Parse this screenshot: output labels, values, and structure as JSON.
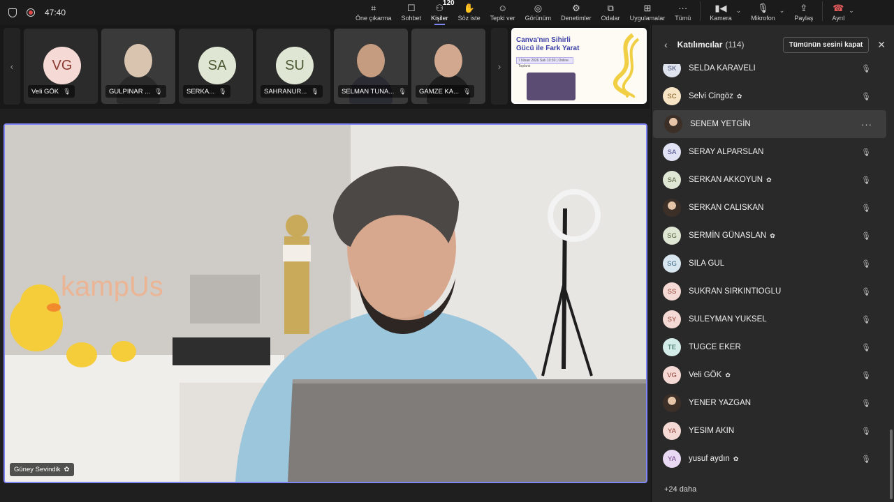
{
  "topbar": {
    "timer": "47:40",
    "actions": [
      {
        "label": "Öne çıkarma",
        "icon": "pin-icon"
      },
      {
        "label": "Sohbet",
        "icon": "chat-icon"
      },
      {
        "label": "Kişiler",
        "icon": "people-icon",
        "badge": "120",
        "active": true
      },
      {
        "label": "Söz iste",
        "icon": "raise-hand-icon"
      },
      {
        "label": "Tepki ver",
        "icon": "reaction-icon"
      },
      {
        "label": "Görünüm",
        "icon": "view-icon"
      },
      {
        "label": "Denetimler",
        "icon": "controls-icon"
      },
      {
        "label": "Odalar",
        "icon": "rooms-icon"
      },
      {
        "label": "Uygulamalar",
        "icon": "apps-icon"
      },
      {
        "label": "Tümü",
        "icon": "more-icon"
      }
    ],
    "camera_label": "Kamera",
    "mic_label": "Mikrofon",
    "share_label": "Paylaş",
    "leave_label": "Ayrıl"
  },
  "filmstrip": {
    "tiles": [
      {
        "name": "Veli GÖK",
        "initials": "VG",
        "avatar_bg": "#f4d9d4",
        "avatar_fg": "#8a3b30"
      },
      {
        "name": "GULPINAR ...",
        "photo": true
      },
      {
        "name": "SERKA...",
        "initials": "SA",
        "avatar_bg": "#dfe6d3",
        "avatar_fg": "#4c5a35"
      },
      {
        "name": "SAHRANUR...",
        "initials": "SU",
        "avatar_bg": "#dfe6d3",
        "avatar_fg": "#4c5a35"
      },
      {
        "name": "SELMAN TUNA...",
        "photo": true
      },
      {
        "name": "GAMZE KA...",
        "photo": true
      }
    ],
    "share": {
      "title_line1": "Canva'nın Sihirli",
      "title_line2": "Gücü ile Fark Yarat",
      "subtitle": "7 Nisan 2026 Salı 10:30 | Online Toplantı"
    }
  },
  "presenter": {
    "name": "Güney Sevindik"
  },
  "panel": {
    "title": "Katılımcılar",
    "count": "(114)",
    "mute_all": "Tümünün sesini kapat",
    "participants": [
      {
        "name": "SELDA KARAVELİ",
        "initials": "SK",
        "bg": "#dfe3ee",
        "fg": "#3f4a6b",
        "badge": false
      },
      {
        "name": "Selvi Cingöz",
        "initials": "SC",
        "bg": "#f6e4c5",
        "fg": "#7a5317",
        "badge": true
      },
      {
        "name": "SENEM YETGİN",
        "initials": "",
        "photo": true,
        "badge": false,
        "highlight": true
      },
      {
        "name": "SERAY ALPARSLAN",
        "initials": "SA",
        "bg": "#e2e2f5",
        "fg": "#3e3e80",
        "badge": false
      },
      {
        "name": "SERKAN AKKOYUN",
        "initials": "SA",
        "bg": "#dfe6d3",
        "fg": "#4c5a35",
        "badge": true
      },
      {
        "name": "SERKAN CALISKAN",
        "initials": "",
        "photo": true,
        "badge": false
      },
      {
        "name": "SERMİN GÜNASLAN",
        "initials": "SG",
        "bg": "#dfe6d3",
        "fg": "#4c5a35",
        "badge": true
      },
      {
        "name": "SILA GUL",
        "initials": "SG",
        "bg": "#d8e6ef",
        "fg": "#2f5b77",
        "badge": false
      },
      {
        "name": "SUKRAN SIRKINTIOGLU",
        "initials": "SS",
        "bg": "#f4d9d4",
        "fg": "#8a3b30",
        "badge": false
      },
      {
        "name": "SULEYMAN YUKSEL",
        "initials": "SY",
        "bg": "#f4d9d4",
        "fg": "#8a3b30",
        "badge": false
      },
      {
        "name": "TUGCE EKER",
        "initials": "TE",
        "bg": "#d3ece8",
        "fg": "#2d6158",
        "badge": false
      },
      {
        "name": "Veli GÖK",
        "initials": "VG",
        "bg": "#f4d9d4",
        "fg": "#8a3b30",
        "badge": true
      },
      {
        "name": "YENER YAZGAN",
        "initials": "",
        "photo": true,
        "badge": false
      },
      {
        "name": "YESIM AKIN",
        "initials": "YA",
        "bg": "#f4d9d4",
        "fg": "#8a3b30",
        "badge": false
      },
      {
        "name": "yusuf aydın",
        "initials": "YA",
        "bg": "#ead9f2",
        "fg": "#6a3b80",
        "badge": true
      }
    ],
    "more_label": "+24 daha"
  },
  "colors": {
    "accent": "#7f85f5",
    "leave": "#e25a5a",
    "panel_bg": "#292929"
  }
}
